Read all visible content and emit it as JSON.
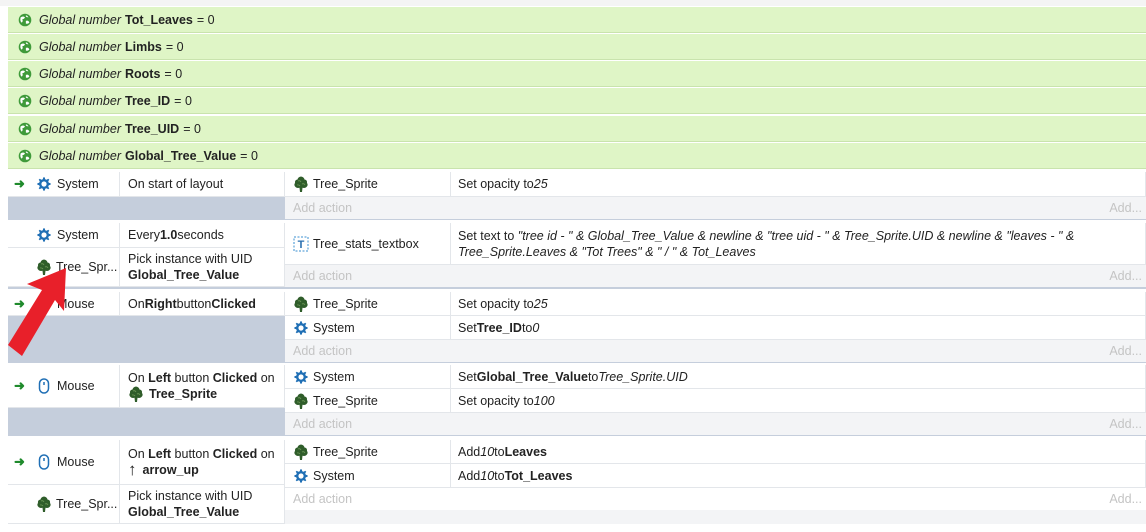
{
  "globals": [
    {
      "prefix": "Global number",
      "name": "Tot_Leaves",
      "value": "= 0"
    },
    {
      "prefix": "Global number",
      "name": "Limbs",
      "value": "= 0"
    },
    {
      "prefix": "Global number",
      "name": "Roots",
      "value": "= 0"
    },
    {
      "prefix": "Global number",
      "name": "Tree_ID",
      "value": "= 0"
    },
    {
      "prefix": "Global number",
      "name": "Tree_UID",
      "value": "= 0"
    },
    {
      "prefix": "Global number",
      "name": "Global_Tree_Value",
      "value": "= 0"
    }
  ],
  "add_action": "Add action",
  "add_short": "Add...",
  "ev1": {
    "obj": "System",
    "cond": "On start of layout",
    "a1_obj": "Tree_Sprite",
    "a1_t1": "Set opacity to ",
    "a1_v": "25"
  },
  "ev2": {
    "obj1": "System",
    "c1_pre": "Every ",
    "c1_val": "1.0",
    "c1_post": " seconds",
    "obj2": "Tree_Spr...",
    "c2_line1": "Pick instance with UID",
    "c2_line2": "Global_Tree_Value",
    "a1_obj": "Tree_stats_textbox",
    "a1_pre": "Set text to ",
    "a1_expr1": "\"tree id - \" & Global_Tree_Value & newline & \"tree uid - \" & Tree_Sprite.UID & newline & \"leaves - \" &",
    "a1_expr2": "Tree_Sprite.Leaves & \"Tot Trees\" & \" / \" & Tot_Leaves"
  },
  "ev3": {
    "obj": "Mouse",
    "c_on": "On ",
    "c_btn": "Right",
    "c_mid": " button ",
    "c_clk": "Clicked",
    "a1_obj": "Tree_Sprite",
    "a1_pre": "Set opacity to ",
    "a1_v": "25",
    "a2_obj": "System",
    "a2_pre": "Set ",
    "a2_var": "Tree_ID",
    "a2_mid": " to ",
    "a2_v": "0"
  },
  "ev4": {
    "obj": "Mouse",
    "c_on": "On ",
    "c_btn": "Left",
    "c_mid": " button ",
    "c_clk": "Clicked",
    "c_post": " on",
    "c_target": "Tree_Sprite",
    "a1_obj": "System",
    "a1_pre": "Set ",
    "a1_var": "Global_Tree_Value",
    "a1_mid": " to ",
    "a1_v": "Tree_Sprite.UID",
    "a2_obj": "Tree_Sprite",
    "a2_pre": "Set opacity to ",
    "a2_v": "100"
  },
  "ev5": {
    "obj1": "Mouse",
    "c_on": "On ",
    "c_btn": "Left",
    "c_mid": " button ",
    "c_clk": "Clicked",
    "c_post": " on",
    "c_target": "arrow_up",
    "obj2": "Tree_Spr...",
    "c2_line1": "Pick instance with UID",
    "c2_line2": "Global_Tree_Value",
    "a1_obj": "Tree_Sprite",
    "a1_pre": "Add ",
    "a1_v": "10",
    "a1_mid": " to ",
    "a1_var": "Leaves",
    "a2_obj": "System",
    "a2_pre": "Add ",
    "a2_v": "10",
    "a2_mid": " to ",
    "a2_var": "Tot_Leaves"
  },
  "colors": {
    "global_bg": "#dff5c6",
    "event_bar": "#c5cedc",
    "arrow_red": "#e8202a",
    "tree_green": "#2f5d2a",
    "gear_blue": "#1f6fb5"
  }
}
